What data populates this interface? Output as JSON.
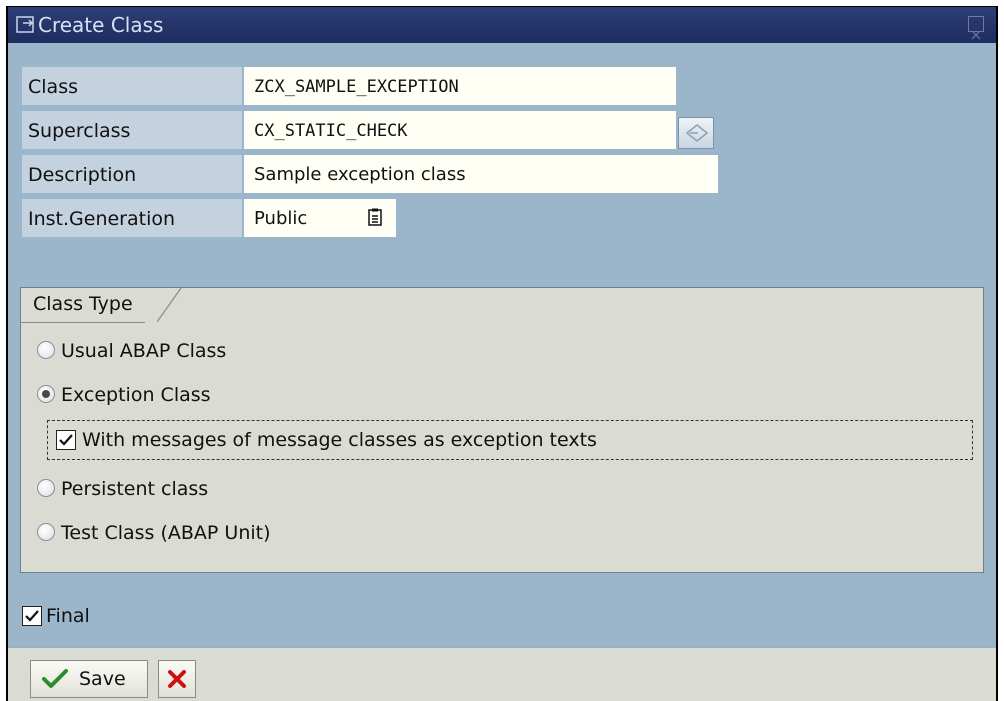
{
  "window": {
    "title": "Create Class",
    "title_icon": "window-icon",
    "close_icon": "close-icon"
  },
  "form": {
    "class_label": "Class",
    "class_value": "ZCX_SAMPLE_EXCEPTION",
    "superclass_label": "Superclass",
    "superclass_value": "CX_STATIC_CHECK",
    "superclass_button_icon": "undo-superclass-icon",
    "description_label": "Description",
    "description_value": "Sample exception class",
    "inst_generation_label": "Inst.Generation",
    "inst_generation_value": "Public",
    "inst_generation_icon": "dropdown-list-icon"
  },
  "class_type": {
    "group_label": "Class Type",
    "options": [
      {
        "label": "Usual ABAP Class",
        "selected": false
      },
      {
        "label": "Exception Class",
        "selected": true
      },
      {
        "label": "Persistent class",
        "selected": false
      },
      {
        "label": "Test Class (ABAP Unit)",
        "selected": false
      }
    ],
    "messages_checkbox": {
      "label": "With messages of message classes as exception texts",
      "checked": true
    }
  },
  "final_checkbox": {
    "label": "Final",
    "checked": true
  },
  "footer": {
    "save_label": "Save",
    "save_icon": "checkmark-icon",
    "cancel_icon": "cancel-x-icon"
  },
  "colors": {
    "title_bar": "#1e2c5f",
    "background": "#9bb6cb",
    "label_bg": "#c3d2de",
    "field_bg": "#fffff6",
    "group_bg": "#dadbd3",
    "save_check": "#2e8b2e",
    "cancel_x": "#cc1111"
  }
}
